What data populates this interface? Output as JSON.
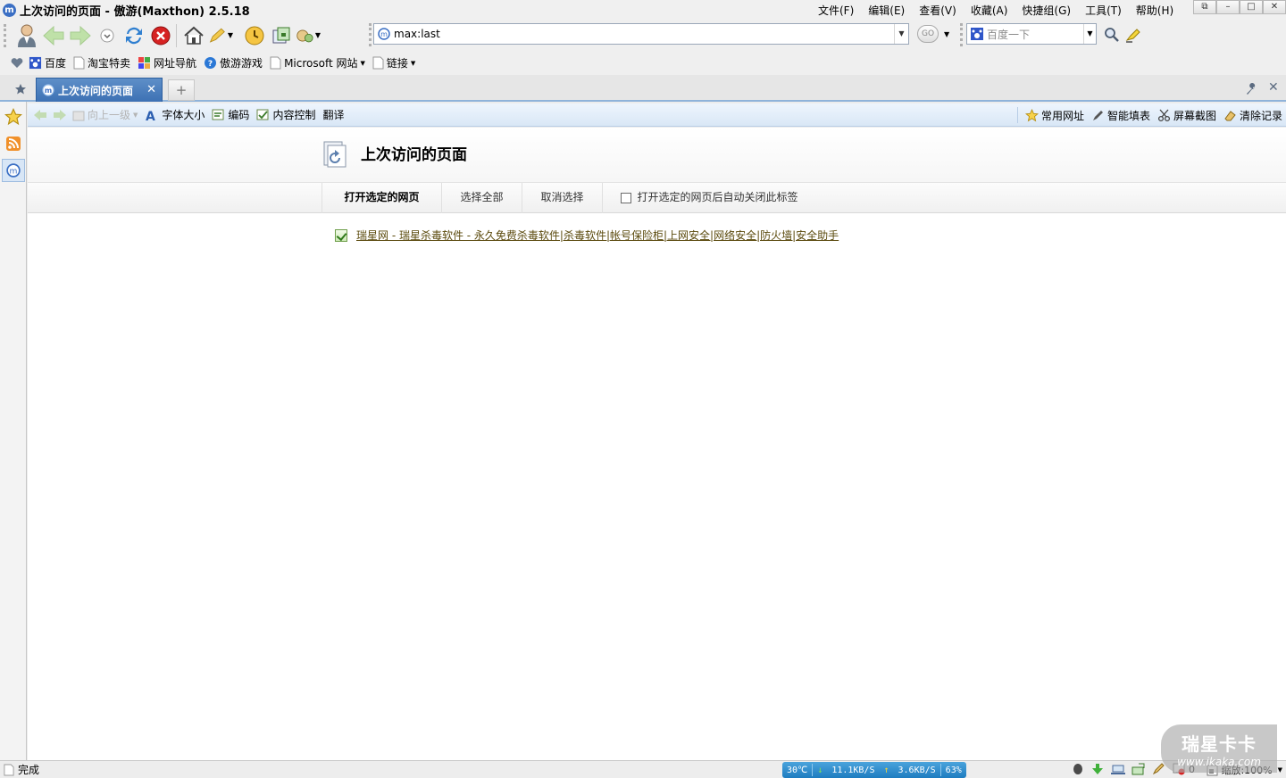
{
  "window": {
    "title": "上次访问的页面 - 傲游(Maxthon) 2.5.18",
    "app_icon_letter": "m",
    "buttons": [
      "restore",
      "minimize",
      "maximize",
      "close"
    ]
  },
  "menu": [
    "文件(F)",
    "编辑(E)",
    "查看(V)",
    "收藏(A)",
    "快捷组(G)",
    "工具(T)",
    "帮助(H)"
  ],
  "toolbar": {
    "address_value": "max:last",
    "go_label": "GO",
    "search_placeholder": "百度一下"
  },
  "favorites": [
    {
      "label": "百度",
      "icon": "baidu-icon"
    },
    {
      "label": "淘宝特卖",
      "icon": "page-icon"
    },
    {
      "label": "网址导航",
      "icon": "nav-icon"
    },
    {
      "label": "傲游游戏",
      "icon": "game-icon"
    },
    {
      "label": "Microsoft 网站",
      "icon": "page-icon"
    },
    {
      "label": "链接",
      "icon": "page-icon"
    }
  ],
  "tabs": [
    {
      "label": "上次访问的页面",
      "active": true
    }
  ],
  "pagebar": {
    "back_up": "向上一级",
    "font_size": "字体大小",
    "encoding": "编码",
    "content_control": "内容控制",
    "translate": "翻译",
    "common_sites": "常用网址",
    "smart_fill": "智能填表",
    "screenshot": "屏幕截图",
    "clear_history": "清除记录"
  },
  "page": {
    "title": "上次访问的页面",
    "actions": {
      "open_selected": "打开选定的网页",
      "select_all": "选择全部",
      "deselect": "取消选择",
      "auto_close": "打开选定的网页后自动关闭此标签"
    },
    "items": [
      {
        "text": "瑞星网 - 瑞星杀毒软件 - 永久免费杀毒软件|杀毒软件|帐号保险柜|上网安全|网络安全|防火墙|安全助手",
        "checked": true
      }
    ]
  },
  "status": {
    "text": "完成",
    "temp": "30℃",
    "down_speed": "11.1KB/S",
    "up_speed": "3.6KB/S",
    "cpu": "63%",
    "popup_count": "0",
    "zoom": "缩放:100%"
  },
  "watermark": {
    "line1": "瑞星卡卡",
    "line2": "www.ikaka.com"
  },
  "colors": {
    "tab_active": "#3d71b4",
    "pagebar_bg": "#d9e7f6",
    "link": "#5b4a0d",
    "net_box": "#1e7cc0"
  }
}
